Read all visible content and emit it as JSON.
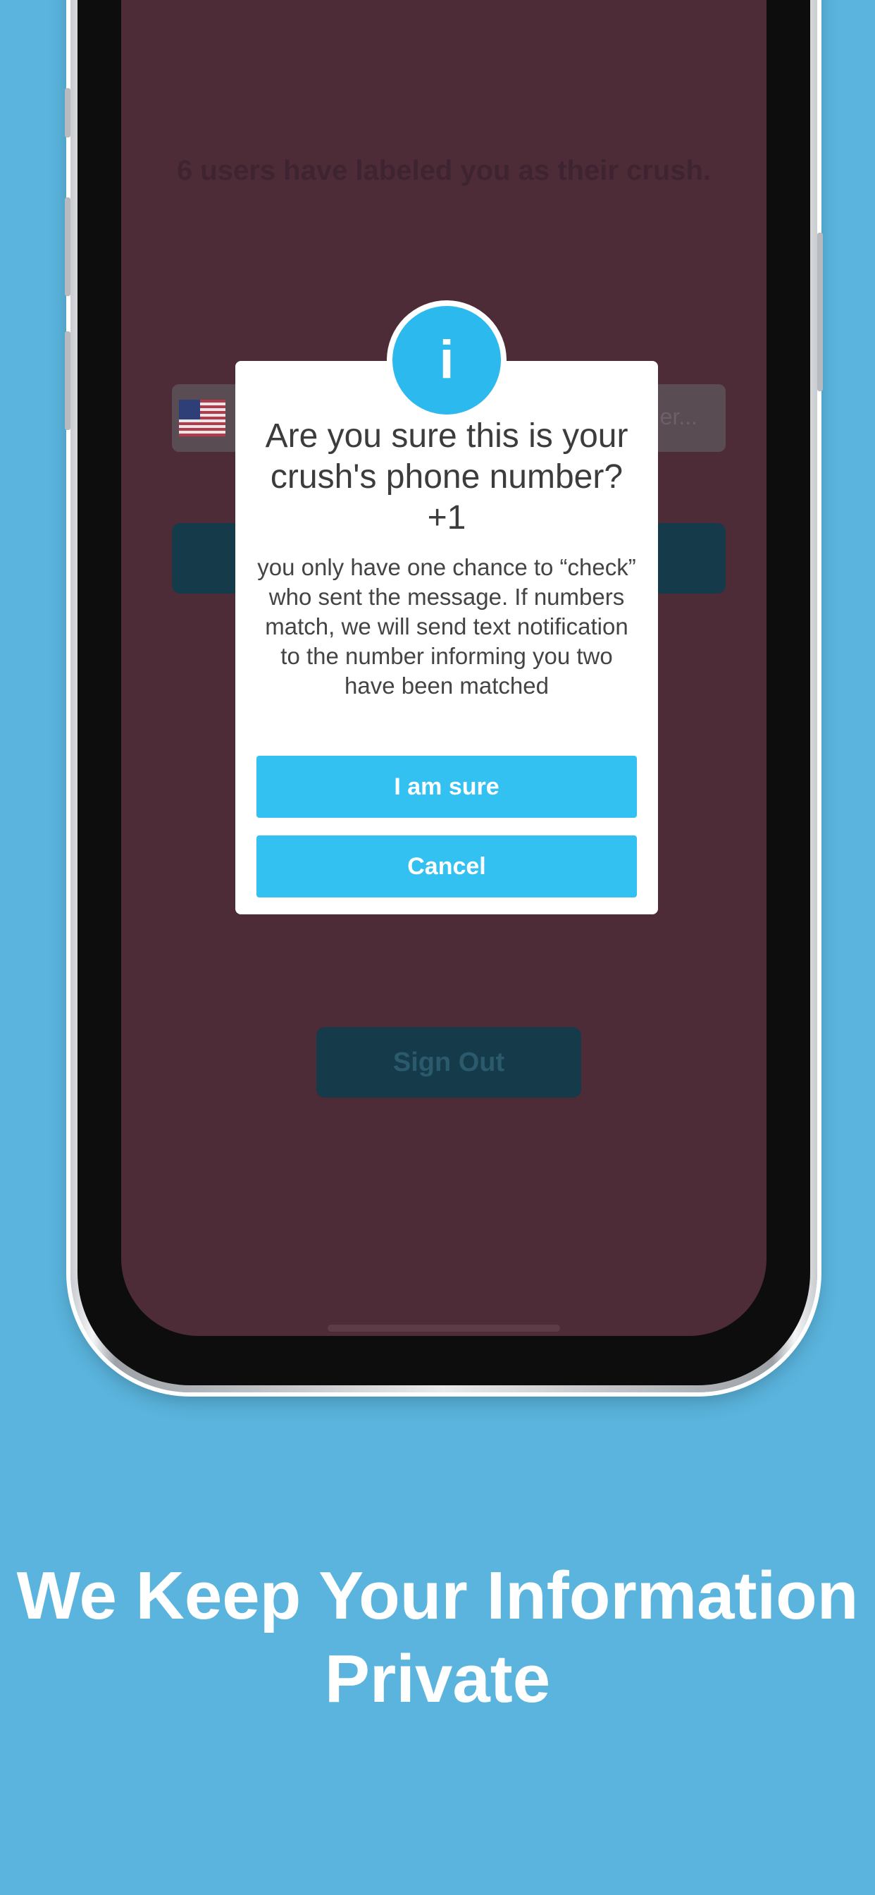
{
  "background_color": "#5ab4dd",
  "screen": {
    "background_color": "#4d2c37",
    "crush_count_text": "6 users have labeled you as their crush.",
    "phone_input_placeholder": "er...",
    "sign_out_label": "Sign Out"
  },
  "dialog": {
    "info_glyph": "i",
    "title": "Are you sure this is your crush's phone number?",
    "phone_number": "+1",
    "message": "you only have one chance to “check” who sent the message. If numbers match, we will send text notification to the number informing you two have been matched",
    "confirm_label": "I am sure",
    "cancel_label": "Cancel",
    "accent_color": "#33c1f2"
  },
  "caption": "We Keep Your Information Private",
  "icons": [
    "info-icon",
    "us-flag-icon"
  ]
}
